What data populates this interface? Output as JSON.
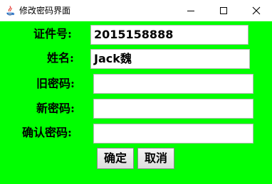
{
  "window": {
    "title": "修改密码界面",
    "app_icon": "java-icon"
  },
  "form": {
    "id_label": "证件号:",
    "id_value": "2015158888",
    "name_label": "姓名:",
    "name_value": "Jack魏",
    "old_password_label": "旧密码:",
    "old_password_value": "",
    "new_password_label": "新密码:",
    "new_password_value": "",
    "confirm_password_label": "确认密码:",
    "confirm_password_value": ""
  },
  "buttons": {
    "confirm": "确定",
    "cancel": "取消"
  },
  "colors": {
    "background": "#00ff00"
  }
}
